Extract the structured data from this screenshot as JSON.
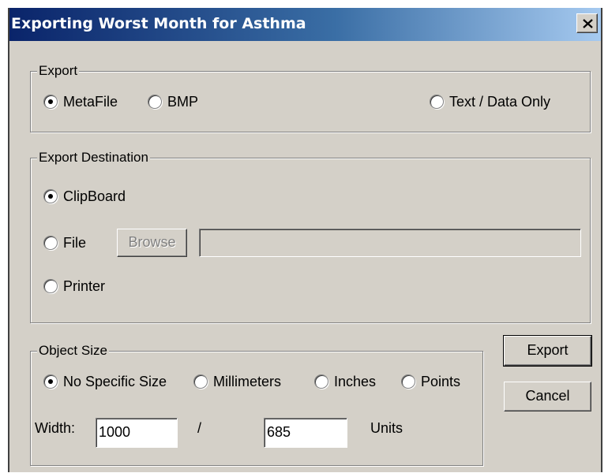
{
  "window": {
    "title": "Exporting Worst Month for Asthma",
    "close_label": "close-icon"
  },
  "export_group": {
    "legend": "Export",
    "options": [
      {
        "label": "MetaFile",
        "selected": true
      },
      {
        "label": "BMP",
        "selected": false
      },
      {
        "label": "Text / Data Only",
        "selected": false
      }
    ]
  },
  "destination_group": {
    "legend": "Export Destination",
    "options": [
      {
        "label": "ClipBoard",
        "selected": true
      },
      {
        "label": "File",
        "selected": false
      },
      {
        "label": "Printer",
        "selected": false
      }
    ],
    "browse_label": "Browse",
    "file_path_value": ""
  },
  "size_group": {
    "legend": "Object Size",
    "options": [
      {
        "label": "No Specific Size",
        "selected": true
      },
      {
        "label": "Millimeters",
        "selected": false
      },
      {
        "label": "Inches",
        "selected": false
      },
      {
        "label": "Points",
        "selected": false
      }
    ],
    "width_label": "Width:",
    "width_value": "1000",
    "separator": "/",
    "height_value": "685",
    "units_label": "Units"
  },
  "buttons": {
    "export_label": "Export",
    "cancel_label": "Cancel"
  },
  "colors": {
    "title_gradient_start": "#0a246a",
    "title_gradient_end": "#a6caf0",
    "dialog_face": "#d4d0c8"
  }
}
